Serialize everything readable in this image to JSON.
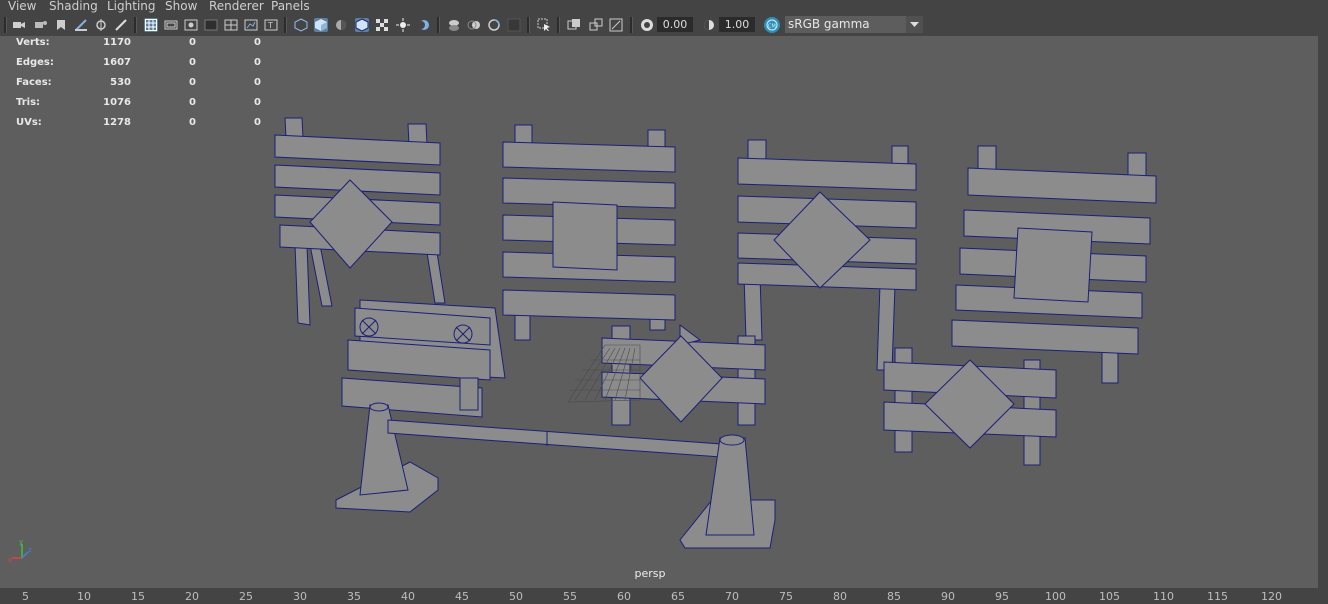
{
  "menu": [
    "View",
    "Shading",
    "Lighting",
    "Show",
    "Renderer",
    "Panels"
  ],
  "toolbar": {
    "exposure_value": "0.00",
    "gamma_value": "1.00",
    "color_management": "sRGB gamma"
  },
  "hud": {
    "rows": [
      {
        "label": "Verts:",
        "v1": "1170",
        "v2": "0",
        "v3": "0"
      },
      {
        "label": "Edges:",
        "v1": "1607",
        "v2": "0",
        "v3": "0"
      },
      {
        "label": "Faces:",
        "v1": "530",
        "v2": "0",
        "v3": "0"
      },
      {
        "label": "Tris:",
        "v1": "1076",
        "v2": "0",
        "v3": "0"
      },
      {
        "label": "UVs:",
        "v1": "1278",
        "v2": "0",
        "v3": "0"
      }
    ]
  },
  "camera_label": "persp",
  "timeline": {
    "ticks": [
      "5",
      "10",
      "15",
      "20",
      "25",
      "30",
      "35",
      "40",
      "45",
      "50",
      "55",
      "60",
      "65",
      "70",
      "75",
      "80",
      "85",
      "90",
      "95",
      "100",
      "105",
      "110",
      "115",
      "120"
    ]
  },
  "colors": {
    "viewport_bg": "#5e5e5e",
    "mesh_fill": "#8c8c8c",
    "wire": "#1b1f78",
    "accent": "#5d80a0"
  }
}
